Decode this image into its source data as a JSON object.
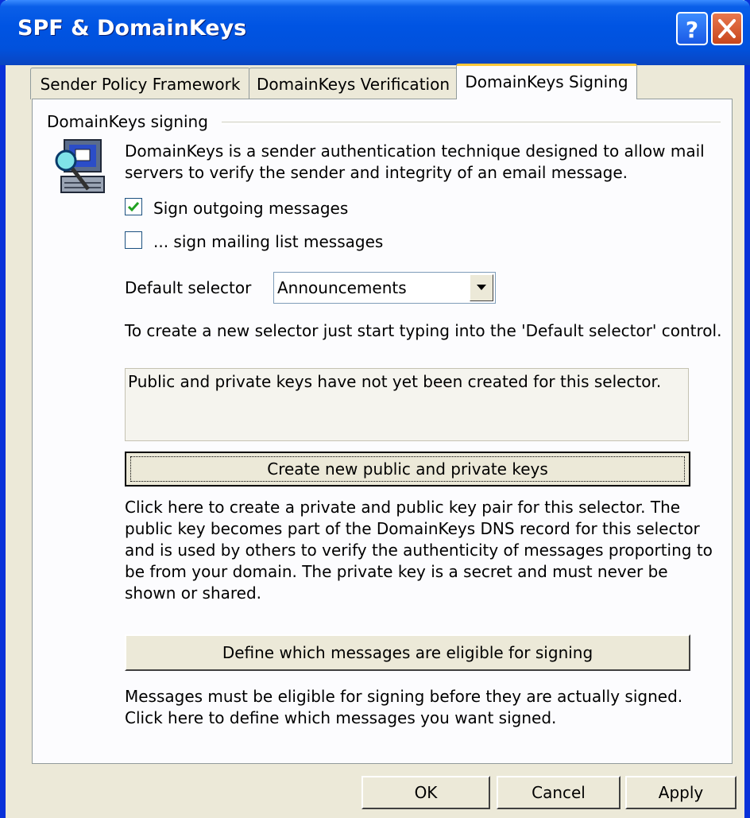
{
  "window": {
    "title": "SPF & DomainKeys",
    "help_icon": "question-mark-icon",
    "close_icon": "close-x-icon"
  },
  "tabs": [
    {
      "label": "Sender Policy Framework",
      "active": false
    },
    {
      "label": "DomainKeys Verification",
      "active": false
    },
    {
      "label": "DomainKeys Signing",
      "active": true
    }
  ],
  "group": {
    "title": "DomainKeys signing",
    "icon": "computer-magnifier-icon",
    "description_line1": "DomainKeys is a sender authentication technique designed to allow mail",
    "description_line2": "servers to verify the sender and integrity of an email message."
  },
  "checkboxes": {
    "sign_outgoing": {
      "label": "Sign outgoing messages",
      "checked": true
    },
    "sign_mailing_list": {
      "label": "... sign mailing list messages",
      "checked": false
    }
  },
  "selector": {
    "label": "Default selector",
    "value": "Announcements",
    "hint": "To create a new selector just start typing into the 'Default selector' control."
  },
  "keys_status": "Public and private keys have not yet been created for this selector.",
  "create_keys": {
    "button_label": "Create new public and private keys",
    "help_lines": [
      "Click here to create a private and public key pair for this selector.  The",
      "public key becomes part of the DomainKeys DNS record for this selector",
      "and is used by others to verify the authenticity of messages proporting to",
      "be from your domain.  The private key is a secret and must never be",
      "shown or shared."
    ]
  },
  "eligibility": {
    "button_label": "Define which messages are eligible for signing",
    "help_lines": [
      "Messages must be eligible for signing before they are actually signed.",
      "Click here to define which messages you want signed."
    ]
  },
  "footer": {
    "ok": "OK",
    "cancel": "Cancel",
    "apply": "Apply"
  },
  "colors": {
    "title_bar": "#0054E3",
    "dialog_bg": "#ECE9D8",
    "tab_highlight": "#FFC83C"
  }
}
